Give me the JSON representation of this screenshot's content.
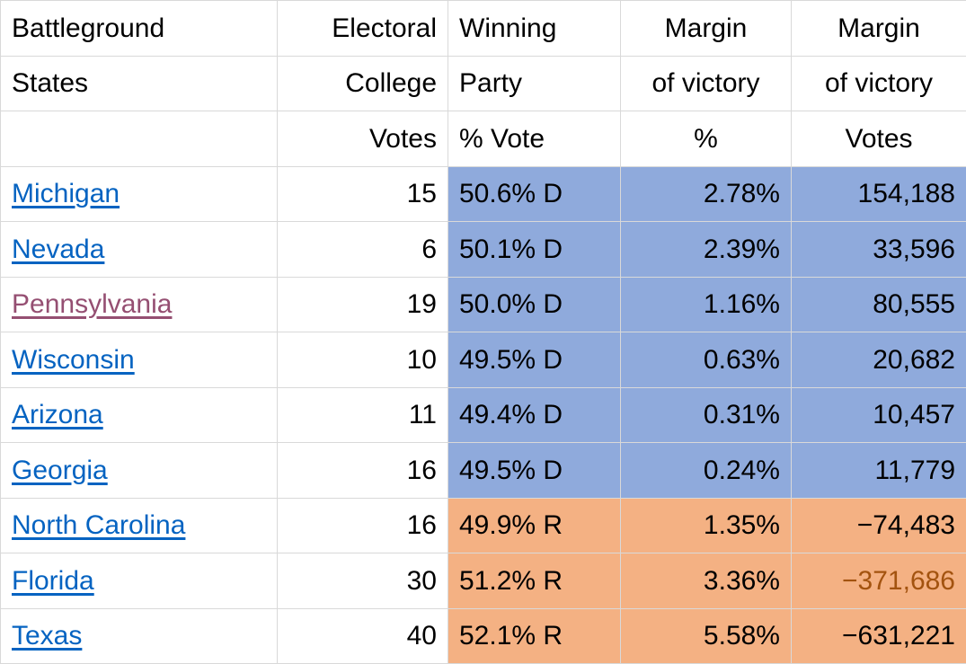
{
  "table": {
    "header_rows": [
      [
        "Battleground",
        "Electoral",
        "Winning",
        "Margin",
        "Margin"
      ],
      [
        "States",
        "College",
        "Party",
        "of victory",
        "of victory"
      ],
      [
        "",
        "Votes",
        "% Vote",
        "%",
        "Votes"
      ]
    ],
    "columns": [
      {
        "key": "state",
        "label": "Battleground States",
        "align": "left"
      },
      {
        "key": "ecv",
        "label": "Electoral College Votes",
        "align": "right"
      },
      {
        "key": "party",
        "label": "Winning Party % Vote",
        "align": "left"
      },
      {
        "key": "mpct",
        "label": "Margin of victory %",
        "align": "right"
      },
      {
        "key": "mvotes",
        "label": "Margin of victory Votes",
        "align": "right"
      }
    ],
    "rows": [
      {
        "state": "Michigan",
        "state_link_state": "unvisited",
        "ecv": "15",
        "party": "50.6% D",
        "mpct": "2.78%",
        "mvotes": "154,188",
        "fill": "blue",
        "mvotes_selected": false
      },
      {
        "state": "Nevada",
        "state_link_state": "unvisited",
        "ecv": "6",
        "party": "50.1% D",
        "mpct": "2.39%",
        "mvotes": "33,596",
        "fill": "blue",
        "mvotes_selected": false
      },
      {
        "state": "Pennsylvania",
        "state_link_state": "visited",
        "ecv": "19",
        "party": "50.0% D",
        "mpct": "1.16%",
        "mvotes": "80,555",
        "fill": "blue",
        "mvotes_selected": false
      },
      {
        "state": "Wisconsin",
        "state_link_state": "unvisited",
        "ecv": "10",
        "party": "49.5% D",
        "mpct": "0.63%",
        "mvotes": "20,682",
        "fill": "blue",
        "mvotes_selected": false
      },
      {
        "state": "Arizona",
        "state_link_state": "unvisited",
        "ecv": "11",
        "party": "49.4% D",
        "mpct": "0.31%",
        "mvotes": "10,457",
        "fill": "blue",
        "mvotes_selected": false
      },
      {
        "state": "Georgia",
        "state_link_state": "unvisited",
        "ecv": "16",
        "party": "49.5% D",
        "mpct": "0.24%",
        "mvotes": "11,779",
        "fill": "blue",
        "mvotes_selected": false
      },
      {
        "state": "North Carolina",
        "state_link_state": "unvisited",
        "ecv": "16",
        "party": "49.9% R",
        "mpct": "1.35%",
        "mvotes": "−74,483",
        "fill": "orange",
        "mvotes_selected": false
      },
      {
        "state": "Florida",
        "state_link_state": "unvisited",
        "ecv": "30",
        "party": "51.2% R",
        "mpct": "3.36%",
        "mvotes": "−371,686",
        "fill": "orange",
        "mvotes_selected": true
      },
      {
        "state": "Texas",
        "state_link_state": "unvisited",
        "ecv": "40",
        "party": "52.1% R",
        "mpct": "5.58%",
        "mvotes": "−631,221",
        "fill": "orange",
        "mvotes_selected": false
      }
    ]
  },
  "colors": {
    "democrat_fill": "#8FAADC",
    "republican_fill": "#F4B183",
    "link_unvisited": "#0563C1",
    "link_visited": "#954F72",
    "selected_value_text": "#A3530F",
    "gridline": "#D9D9D9",
    "text": "#000000"
  }
}
